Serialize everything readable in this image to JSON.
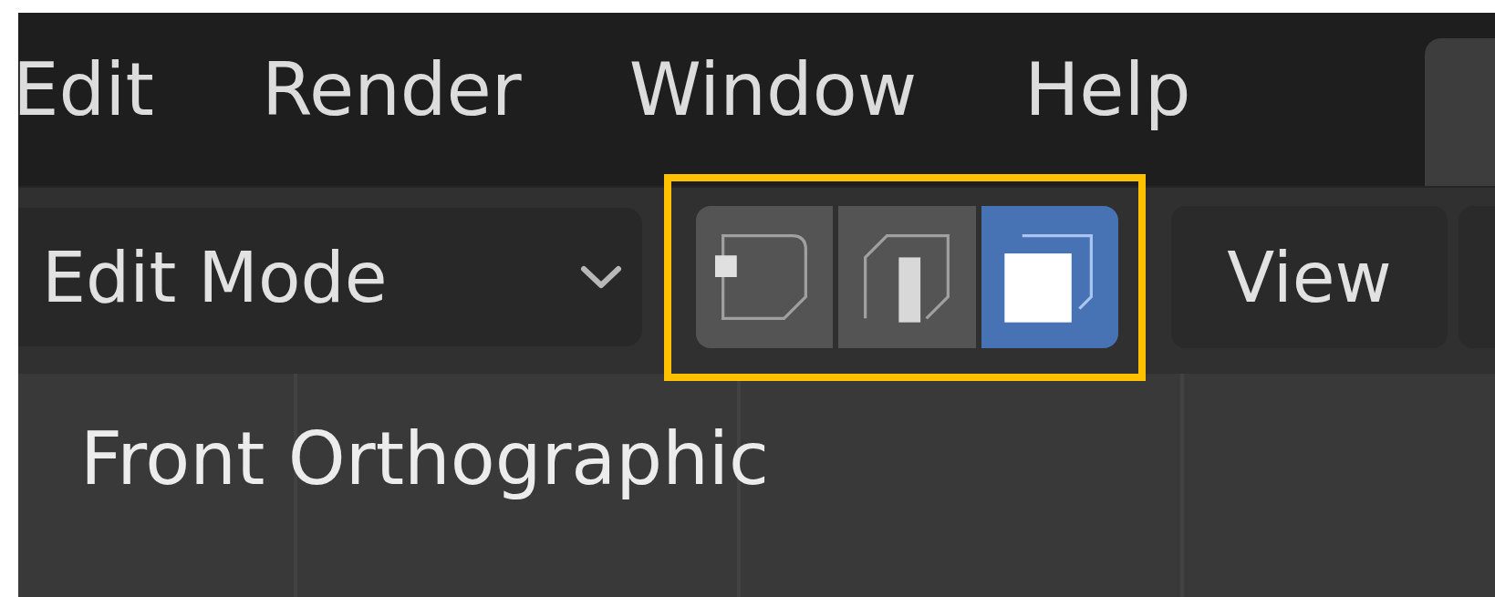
{
  "menu_bar": {
    "items": [
      {
        "label": "Edit"
      },
      {
        "label": "Render"
      },
      {
        "label": "Window"
      },
      {
        "label": "Help"
      }
    ]
  },
  "header": {
    "mode_dropdown": {
      "value": "Edit Mode"
    },
    "select_mode_group": {
      "highlighted": true,
      "modes": [
        {
          "kind": "vertex",
          "selected": false
        },
        {
          "kind": "edge",
          "selected": false
        },
        {
          "kind": "face",
          "selected": true
        }
      ]
    },
    "view_menu": {
      "label": "View"
    }
  },
  "viewport": {
    "overlay_text": "Front Orthographic"
  }
}
